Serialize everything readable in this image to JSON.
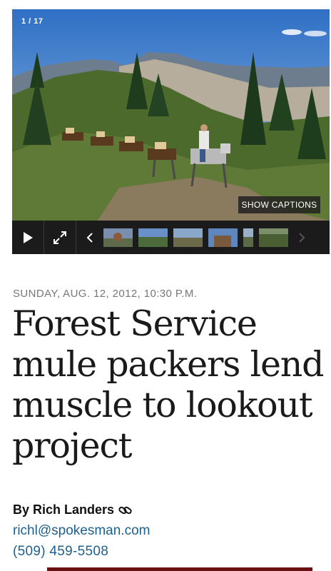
{
  "gallery": {
    "counter": "1 / 17",
    "show_captions": "SHOW CAPTIONS",
    "photo_subject": "mule-pack-train-on-mountain-ridge"
  },
  "article": {
    "dateline": "SUNDAY, AUG. 12, 2012, 10:30 P.M.",
    "headline": "Forest Service mule packers lend muscle to lookout project"
  },
  "author": {
    "byline": "By Rich Landers",
    "email": "richl@spokesman.com",
    "phone": "(509) 459-5508"
  },
  "colors": {
    "link": "#1f5f8b",
    "accent_bar": "#6a1212",
    "dateline": "#777777"
  }
}
